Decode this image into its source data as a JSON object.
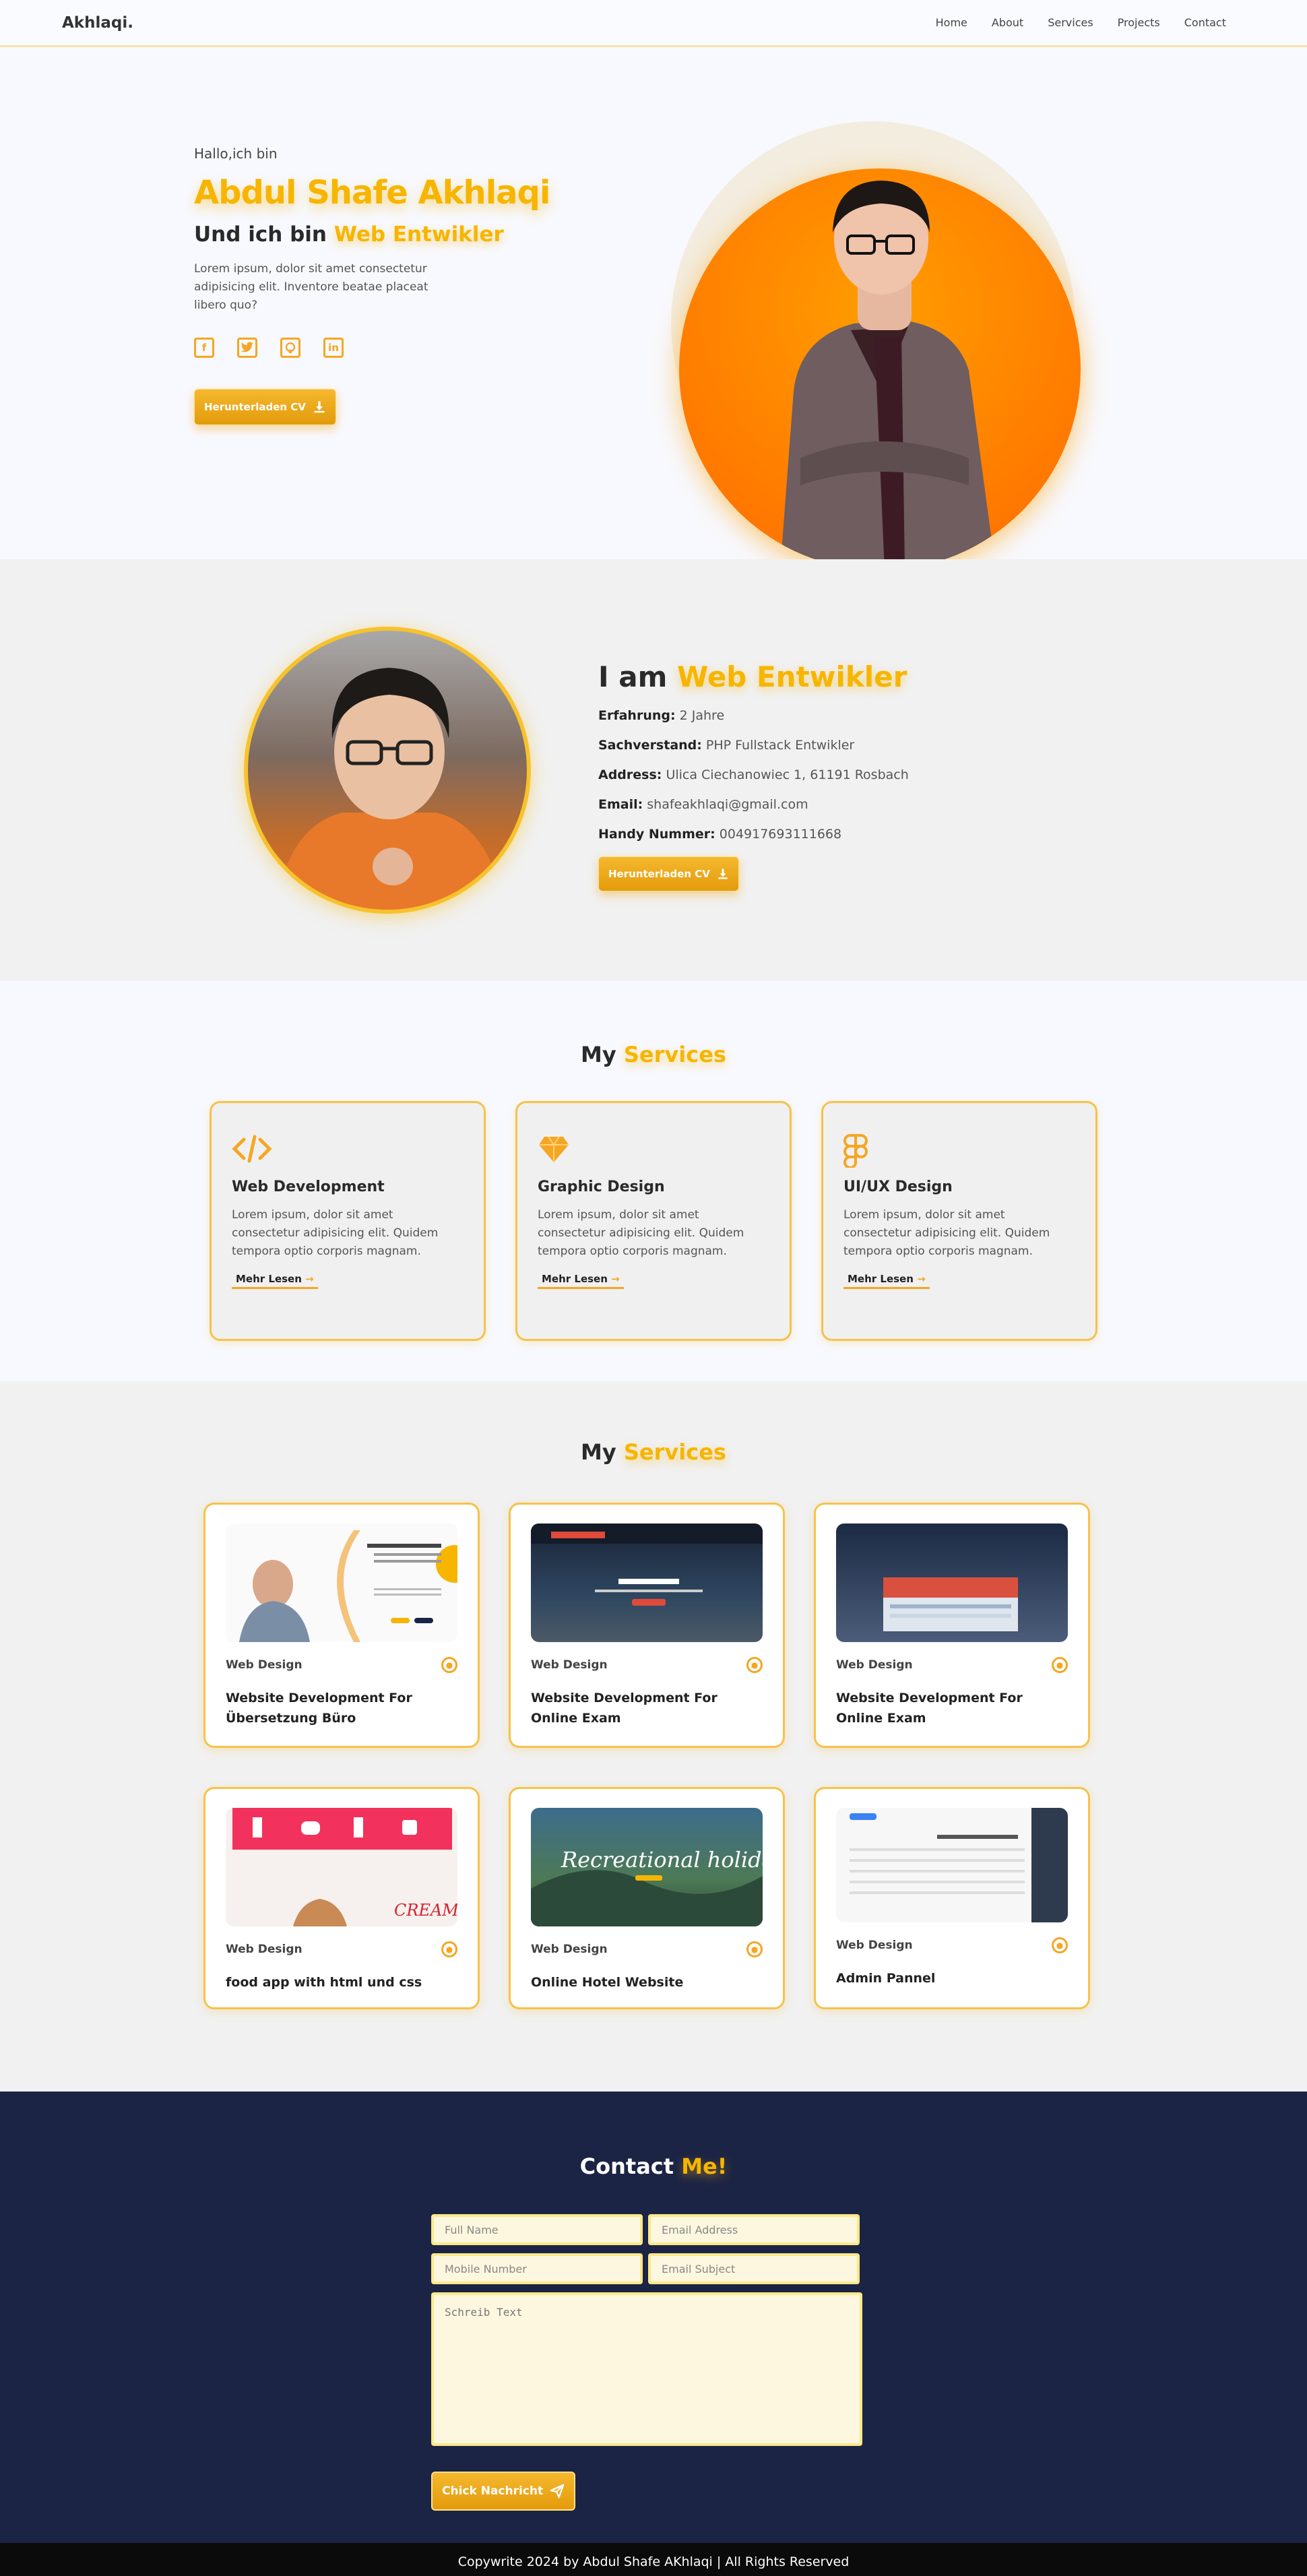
{
  "nav": {
    "logo": "Akhlaqi.",
    "links": [
      "Home",
      "About",
      "Services",
      "Projects",
      "Contact"
    ]
  },
  "hero": {
    "greeting": "Hallo,ich bin",
    "name": "Abdul Shafe Akhlaqi",
    "role_prefix": "Und ich bin",
    "role": "Web Entwikler",
    "description": "Lorem ipsum, dolor sit amet consectetur adipisicing elit. Inventore beatae placeat libero quo?",
    "socials": [
      "facebook-icon",
      "twitter-icon",
      "github-icon",
      "linkedin-icon"
    ],
    "cv_button": "Herunterladen CV"
  },
  "about": {
    "title_prefix": "I am",
    "title_highlight": "Web Entwikler",
    "info": [
      {
        "label": "Erfahrung:",
        "value": "2 Jahre"
      },
      {
        "label": "Sachverstand:",
        "value": "PHP Fullstack Entwikler"
      },
      {
        "label": "Address:",
        "value": "Ulica Ciechanowiec 1, 61191 Rosbach"
      },
      {
        "label": "Email:",
        "value": "shafeakhlaqi@gmail.com"
      },
      {
        "label": "Handy Nummer:",
        "value": "004917693111668"
      }
    ],
    "cv_button": "Herunterladen CV"
  },
  "services": {
    "title_prefix": "My",
    "title_highlight": "Services",
    "items": [
      {
        "icon": "code-icon",
        "title": "Web Development",
        "description": "Lorem ipsum, dolor sit amet consectetur adipisicing elit. Quidem tempora optio corporis magnam.",
        "link": "Mehr Lesen"
      },
      {
        "icon": "diamond-icon",
        "title": "Graphic Design",
        "description": "Lorem ipsum, dolor sit amet consectetur adipisicing elit. Quidem tempora optio corporis magnam.",
        "link": "Mehr Lesen"
      },
      {
        "icon": "figma-icon",
        "title": "UI/UX Design",
        "description": "Lorem ipsum, dolor sit amet consectetur adipisicing elit. Quidem tempora optio corporis magnam.",
        "link": "Mehr Lesen"
      }
    ]
  },
  "projects": {
    "title_prefix": "My",
    "title_highlight": "Services",
    "items": [
      {
        "tag": "Web Design",
        "title": "Website Development For Übersetzung Büro"
      },
      {
        "tag": "Web Design",
        "title": "Website Development For Online Exam"
      },
      {
        "tag": "Web Design",
        "title": "Website Development For Online Exam"
      },
      {
        "tag": "Web Design",
        "title": "food app with html und css"
      },
      {
        "tag": "Web Design",
        "title": "Online Hotel Website"
      },
      {
        "tag": "Web Design",
        "title": "Admin Pannel"
      }
    ]
  },
  "contact": {
    "title_prefix": "Contact",
    "title_highlight": "Me!",
    "placeholders": {
      "full_name": "Full Name",
      "email": "Email Address",
      "mobile": "Mobile Number",
      "subject": "Email Subject",
      "message": "Schreib Text"
    },
    "send_button": "Chick Nachricht"
  },
  "footer": {
    "text": "Copywrite 2024 by Abdul Shafe AKhlaqi | All Rights Reserved"
  },
  "colors": {
    "accent": "#f7b500",
    "orange": "#ff8000",
    "navy": "#1c2445"
  }
}
